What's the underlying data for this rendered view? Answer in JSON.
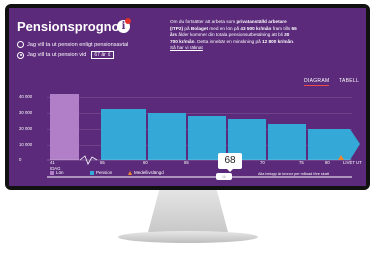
{
  "header": {
    "title": "Pensionsprognos",
    "info_icon": "info-icon"
  },
  "options": {
    "radio1_label": "Jag vill ta ut pension enligt pensionsavtal",
    "radio2_label": "Jag vill ta ut pension vid",
    "radio2_selected": true,
    "age_select": "67 år"
  },
  "description": {
    "p1": "Om du fortsätter att arbeta som ",
    "b1": "privatanställd arbetare (ITP2)",
    "p2": " på ",
    "b2": "Bolaget",
    "p3": " med en lön på ",
    "b3": "43 500 kr/mån",
    "p4": " fram tills ",
    "b4": "65 års",
    "p5": " ålder kommer din totala pensionsutbetalning att bli ",
    "b5": "30 700 kr/mån",
    "p6": ". Detta innebär en minskning på ",
    "b6": "12 800 kr/mån",
    "p7": ". ",
    "link": "Så har vi räknat"
  },
  "tabs": {
    "diagram": "DIAGRAM",
    "tabell": "TABELL",
    "active": "diagram"
  },
  "chart": {
    "y_ticks": [
      "40 000",
      "30 000",
      "20 000",
      "10 000",
      "0"
    ],
    "x_ticks": [
      "41",
      "55",
      "60",
      "65",
      "70",
      "75",
      "80",
      "LIVET UT"
    ],
    "current_age_label": "IDAG",
    "legend": {
      "lon": "Lön",
      "pension": "Pension",
      "median": "Medellivslängd"
    },
    "footnote": "Alla belopp är kronor per månad före skatt",
    "slider_value": "68",
    "slider_thumb": "III",
    "colors": {
      "lon": "#b07fc7",
      "pension": "#34a8d6",
      "median": "#f0862c",
      "bg": "#5b2a7a"
    }
  }
}
